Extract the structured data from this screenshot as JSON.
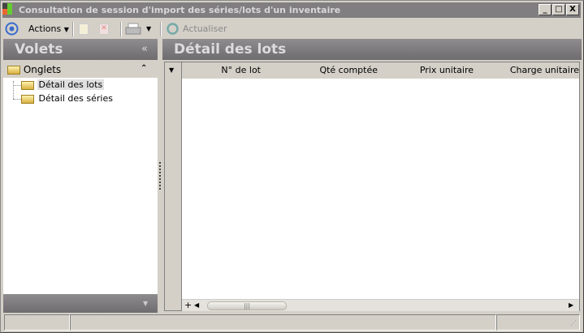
{
  "window": {
    "title": "Consultation de session d'import des séries/lots d'un inventaire",
    "controls": [
      "_",
      "□",
      "X"
    ]
  },
  "toolbar": {
    "actions_label": "Actions",
    "refresh_label": "Actualiser"
  },
  "left_panel": {
    "title": "Volets",
    "collapse_glyph": "«",
    "section": "Onglets",
    "section_toggle": "⌃",
    "items": [
      {
        "label": "Détail des lots",
        "selected": true
      },
      {
        "label": "Détail des séries",
        "selected": false
      }
    ]
  },
  "main": {
    "title": "Détail des lots",
    "columns": [
      "N° de lot",
      "Qté comptée",
      "Prix unitaire",
      "Charge unitaire"
    ],
    "rows": []
  },
  "scrollbar": {
    "add_glyph": "+"
  }
}
